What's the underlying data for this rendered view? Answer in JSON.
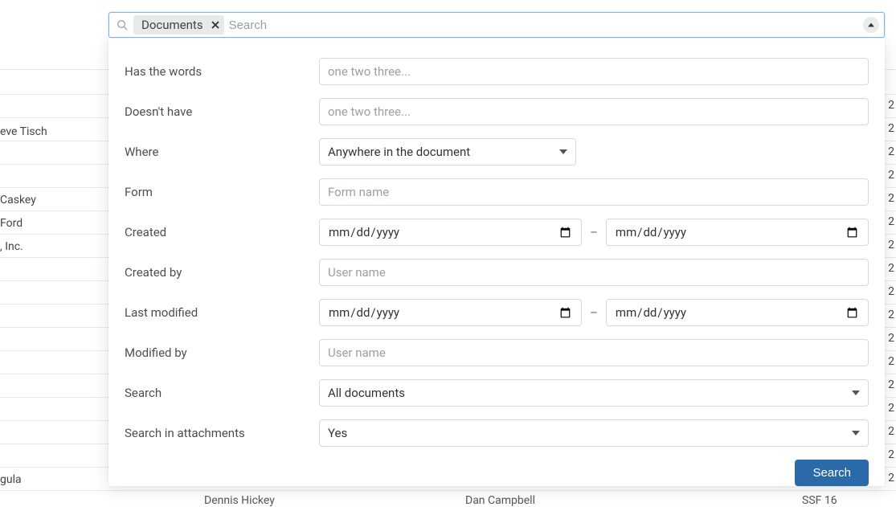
{
  "search": {
    "tag": "Documents",
    "placeholder": "Search"
  },
  "form": {
    "labels": {
      "has_words": "Has the words",
      "doesnt_have": "Doesn't have",
      "where": "Where",
      "form": "Form",
      "created": "Created",
      "created_by": "Created by",
      "last_modified": "Last modified",
      "modified_by": "Modified by",
      "search_scope": "Search",
      "search_attachments": "Search in attachments"
    },
    "placeholders": {
      "words": "one two three...",
      "form_name": "Form name",
      "user_name": "User name",
      "date": "mm/dd/yyyy"
    },
    "where_selected": "Anywhere in the document",
    "scope_selected": "All documents",
    "attachments_selected": "Yes",
    "submit": "Search"
  },
  "background": {
    "rows_left": [
      "eve Tisch",
      "Caskey",
      "Ford",
      ", Inc.",
      "gula"
    ],
    "right_marker": "2",
    "footer": {
      "col1": "Dennis Hickey",
      "col2": "Dan Campbell",
      "col3": "SSF 16"
    }
  }
}
